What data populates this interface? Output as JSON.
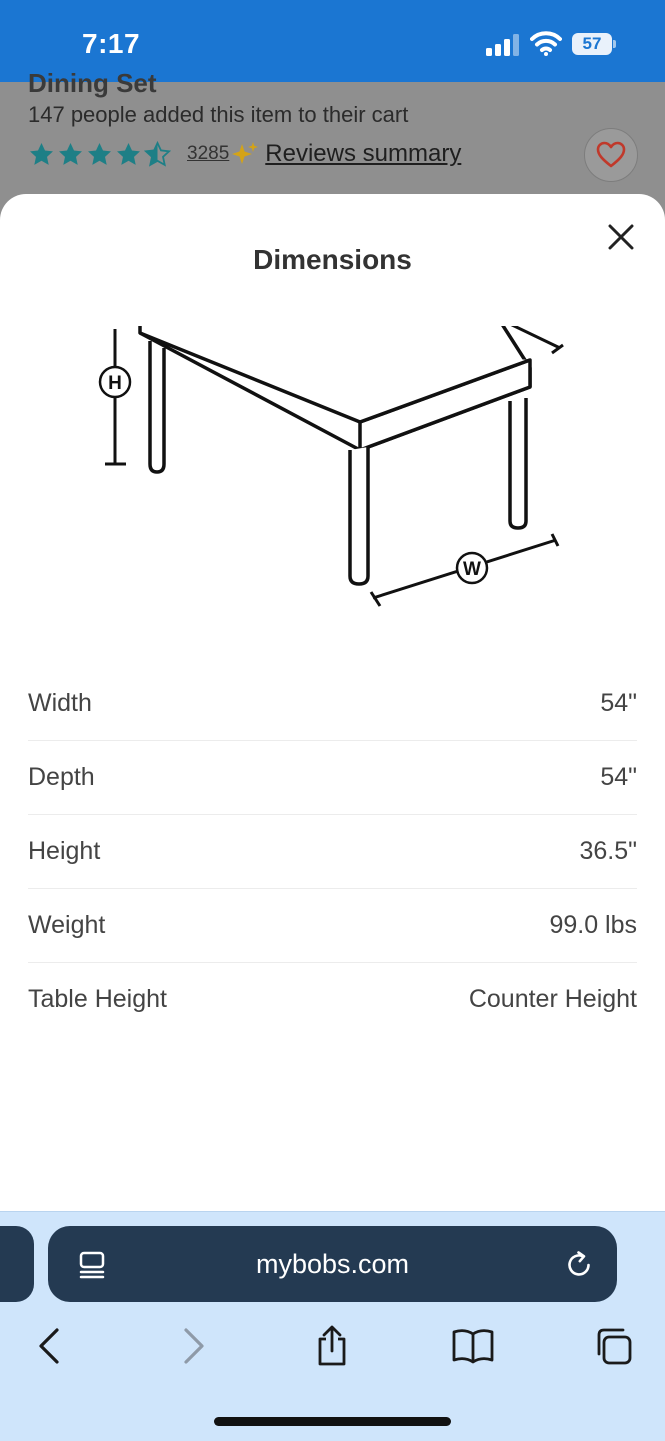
{
  "status_bar": {
    "time": "7:17",
    "battery": "57"
  },
  "background_page": {
    "title_sliver": "Dining Set",
    "cart_text": "147 people added this item to their cart",
    "rating": 4.5,
    "review_count": "3285",
    "reviews_summary": "Reviews summary"
  },
  "sheet": {
    "title": "Dimensions",
    "diagram_labels": {
      "height": "H",
      "width": "W"
    },
    "dimensions": [
      {
        "label": "Width",
        "value": "54\""
      },
      {
        "label": "Depth",
        "value": "54\""
      },
      {
        "label": "Height",
        "value": "36.5\""
      },
      {
        "label": "Weight",
        "value": "99.0 lbs"
      },
      {
        "label": "Table Height",
        "value": "Counter Height"
      }
    ]
  },
  "browser": {
    "url": "mybobs.com"
  },
  "colors": {
    "brand_blue": "#1b76d2",
    "star_teal": "#1e7f86",
    "heart_red": "#c0392b",
    "browser_dark": "#243a52",
    "browser_light": "#cfe5fb"
  }
}
